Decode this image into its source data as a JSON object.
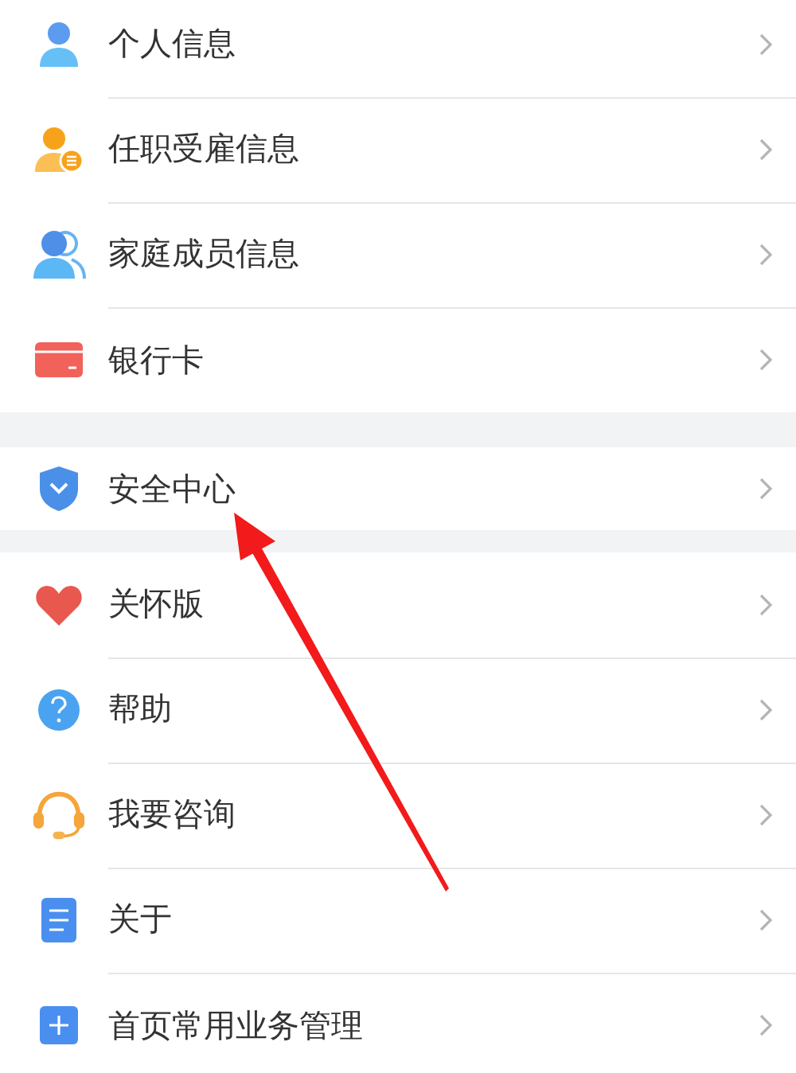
{
  "groups": [
    {
      "items": [
        {
          "label": "个人信息",
          "kind": "person"
        },
        {
          "label": "任职受雇信息",
          "kind": "employee"
        },
        {
          "label": "家庭成员信息",
          "kind": "family"
        },
        {
          "label": "银行卡",
          "kind": "card"
        }
      ]
    },
    {
      "items": [
        {
          "label": "安全中心",
          "kind": "shield"
        }
      ]
    },
    {
      "items": [
        {
          "label": "关怀版",
          "kind": "heart"
        },
        {
          "label": "帮助",
          "kind": "help"
        },
        {
          "label": "我要咨询",
          "kind": "headset"
        },
        {
          "label": "关于",
          "kind": "document"
        },
        {
          "label": "首页常用业务管理",
          "kind": "plus"
        }
      ]
    }
  ]
}
